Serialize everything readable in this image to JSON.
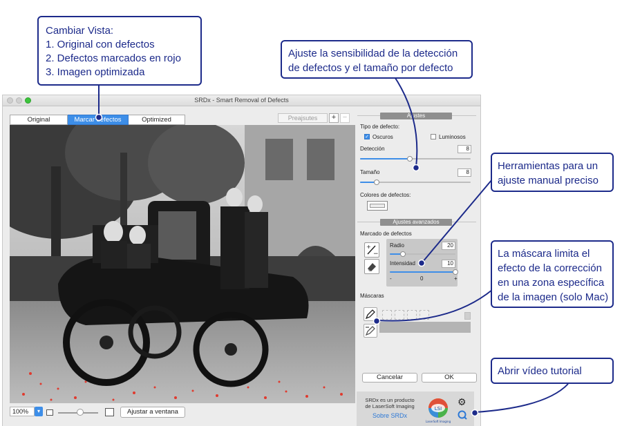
{
  "window": {
    "title": "SRDx - Smart Removal of Defects",
    "tabs": [
      "Original",
      "Marcar defectos",
      "Optimized"
    ],
    "active_tab": "Marcar defectos",
    "presets_label": "Preajsutes",
    "add_preset": "+",
    "remove_preset": "−"
  },
  "bottom_bar": {
    "zoom_value": "100%",
    "fit_button": "Ajustar a ventana"
  },
  "panel": {
    "settings_header": "Ajustes",
    "defect_type_label": "Tipo de defecto:",
    "dark_label": "Oscuros",
    "dark_checked": true,
    "light_label": "Luminosos",
    "light_checked": false,
    "detection_label": "Detección",
    "detection_value": "8",
    "detection_level": 0.45,
    "size_label": "Tamaño",
    "size_value": "8",
    "size_level": 0.15,
    "defect_colors_label": "Colores de defectos:",
    "advanced_header": "Ajustes avanzados",
    "marking_label": "Marcado de defectos",
    "radius_label": "Radio",
    "radius_value": "20",
    "radius_level": 0.2,
    "intensity_label": "Intensidad",
    "intensity_value": "10",
    "intensity_level": 1.0,
    "scale_min": "-",
    "scale_mid": "0",
    "scale_max": "+",
    "masks_label": "Máscaras",
    "cancel_button": "Cancelar",
    "ok_button": "OK"
  },
  "info": {
    "product_text": "SRDx es un producto de LaserSoft Imaging",
    "about_link": "Sobre SRDx",
    "logo_text": "LSI",
    "logo_caption": "LaserSoft Imaging"
  },
  "callouts": {
    "view": {
      "lines": [
        "Cambiar Vista:",
        "1. Original con defectos",
        "2. Defectos marcados en rojo",
        "3. Imagen optimizada"
      ]
    },
    "sensitivity": {
      "lines": [
        "Ajuste la sensibilidad de la detección",
        "de defectos y el tamaño por defecto"
      ]
    },
    "tools": {
      "lines": [
        "Herramientas para un",
        "ajuste manual preciso"
      ]
    },
    "mask": {
      "lines": [
        "La máscara limita el",
        "efecto de la corrección",
        "en una zona específica",
        "de la imagen (solo Mac)"
      ]
    },
    "tutorial": {
      "lines": [
        "Abrir vídeo tutorial"
      ]
    }
  },
  "colors": {
    "accent": "#3d8ee8",
    "callout_border": "#1c2a8a",
    "defect_marks": "#e03a2e"
  }
}
